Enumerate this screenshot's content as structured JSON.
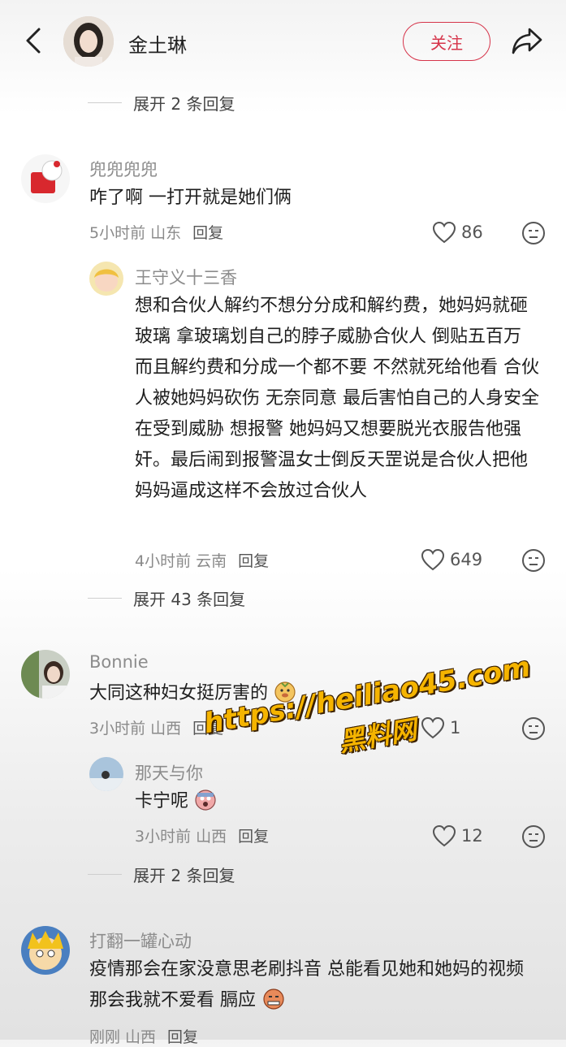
{
  "header": {
    "name": "金土琳",
    "follow_label": "关注"
  },
  "expand_top": "展开 2 条回复",
  "comments": [
    {
      "user": "兜兜兜兜",
      "text": "咋了啊 一打开就是她们俩",
      "time_loc": "5小时前 山东",
      "reply": "回复",
      "likes": "86"
    },
    {
      "user": "王守义十三香",
      "text": "想和合伙人解约不想分分成和解约费，她妈妈就砸玻璃 拿玻璃划自己的脖子威胁合伙人 倒贴五百万 而且解约费和分成一个都不要 不然就死给他看 合伙人被她妈妈砍伤 无奈同意 最后害怕自己的人身安全在受到威胁 想报警 她妈妈又想要脱光衣服告他强奸。最后闹到报警温女士倒反天罡说是合伙人把他妈妈逼成这样不会放过合伙人",
      "time_loc": "4小时前 云南",
      "reply": "回复",
      "likes": "649",
      "expand": "展开 43 条回复"
    },
    {
      "user": "Bonnie",
      "text": "大同这种妇女挺厉害的",
      "time_loc": "3小时前 山西",
      "reply": "回复",
      "likes": "1"
    },
    {
      "user": "那天与你",
      "text": "卡宁呢",
      "time_loc": "3小时前 山西",
      "reply": "回复",
      "likes": "12",
      "expand": "展开 2 条回复"
    },
    {
      "user": "打翻一罐心动",
      "text": "疫情那会在家没意思老刷抖音 总能看见她和她妈的视频 那会我就不爱看 膈应",
      "time_loc": "刚刚 山西",
      "reply": "回复",
      "likes": ""
    }
  ],
  "watermark": {
    "line1": "https://heiliao45.com",
    "line2": "黑料网"
  },
  "colors": {
    "accent": "#d6344a",
    "watermark": "#f5b400"
  }
}
